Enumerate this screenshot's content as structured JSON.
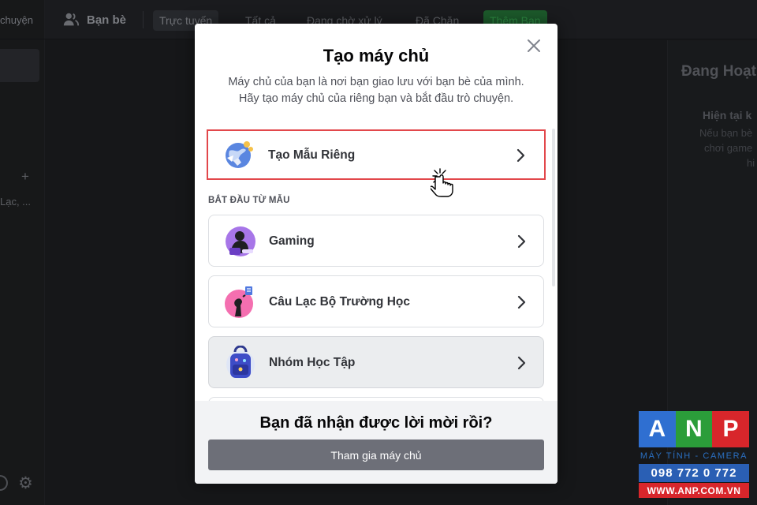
{
  "background": {
    "sidebar": {
      "top_text": "chuyện",
      "truncated_item": "Lạc, ...",
      "add_symbol": "+",
      "settings_icon": "gear-icon",
      "voice_icon": "headset-icon"
    },
    "topbar": {
      "friends_icon": "friends-icon",
      "friends_title": "Bạn bè",
      "tabs": [
        {
          "label": "Trực tuyến",
          "active": true
        },
        {
          "label": "Tất cả",
          "active": false
        },
        {
          "label": "Đang chờ xử lý",
          "active": false
        },
        {
          "label": "Đã Chặn",
          "active": false
        },
        {
          "label": "Thêm Bạn",
          "active": false
        }
      ]
    },
    "active_now": {
      "title": "Đang Hoạt",
      "subtitle": "Hiện tại k",
      "lines": [
        "Nếu bạn bè",
        "chơi game",
        "hi"
      ]
    }
  },
  "modal": {
    "title": "Tạo máy chủ",
    "subtitle_line1": "Máy chủ của bạn là nơi bạn giao lưu với bạn bè của mình.",
    "subtitle_line2": "Hãy tạo máy chủ của riêng bạn và bắt đầu trò chuyện.",
    "close_icon": "close-icon",
    "create_own": {
      "label": "Tạo Mẫu Riêng",
      "icon": "globe-icon"
    },
    "section_label": "BẮT ĐẦU TỪ MẪU",
    "templates": [
      {
        "label": "Gaming",
        "icon": "gaming-icon"
      },
      {
        "label": "Câu Lạc Bộ Trường Học",
        "icon": "school-club-icon"
      },
      {
        "label": "Nhóm Học Tập",
        "icon": "backpack-icon"
      }
    ],
    "footer": {
      "title": "Bạn đã nhận được lời mời rồi?",
      "join_button": "Tham gia máy chủ"
    }
  },
  "watermark": {
    "letters": [
      "A",
      "N",
      "P"
    ],
    "letter_colors": [
      "#2f6fd1",
      "#2b9d3a",
      "#d8262b"
    ],
    "tagline": "MÁY TÍNH - CAMERA",
    "phone": "098 772 0 772",
    "website": "WWW.ANP.COM.VN"
  }
}
